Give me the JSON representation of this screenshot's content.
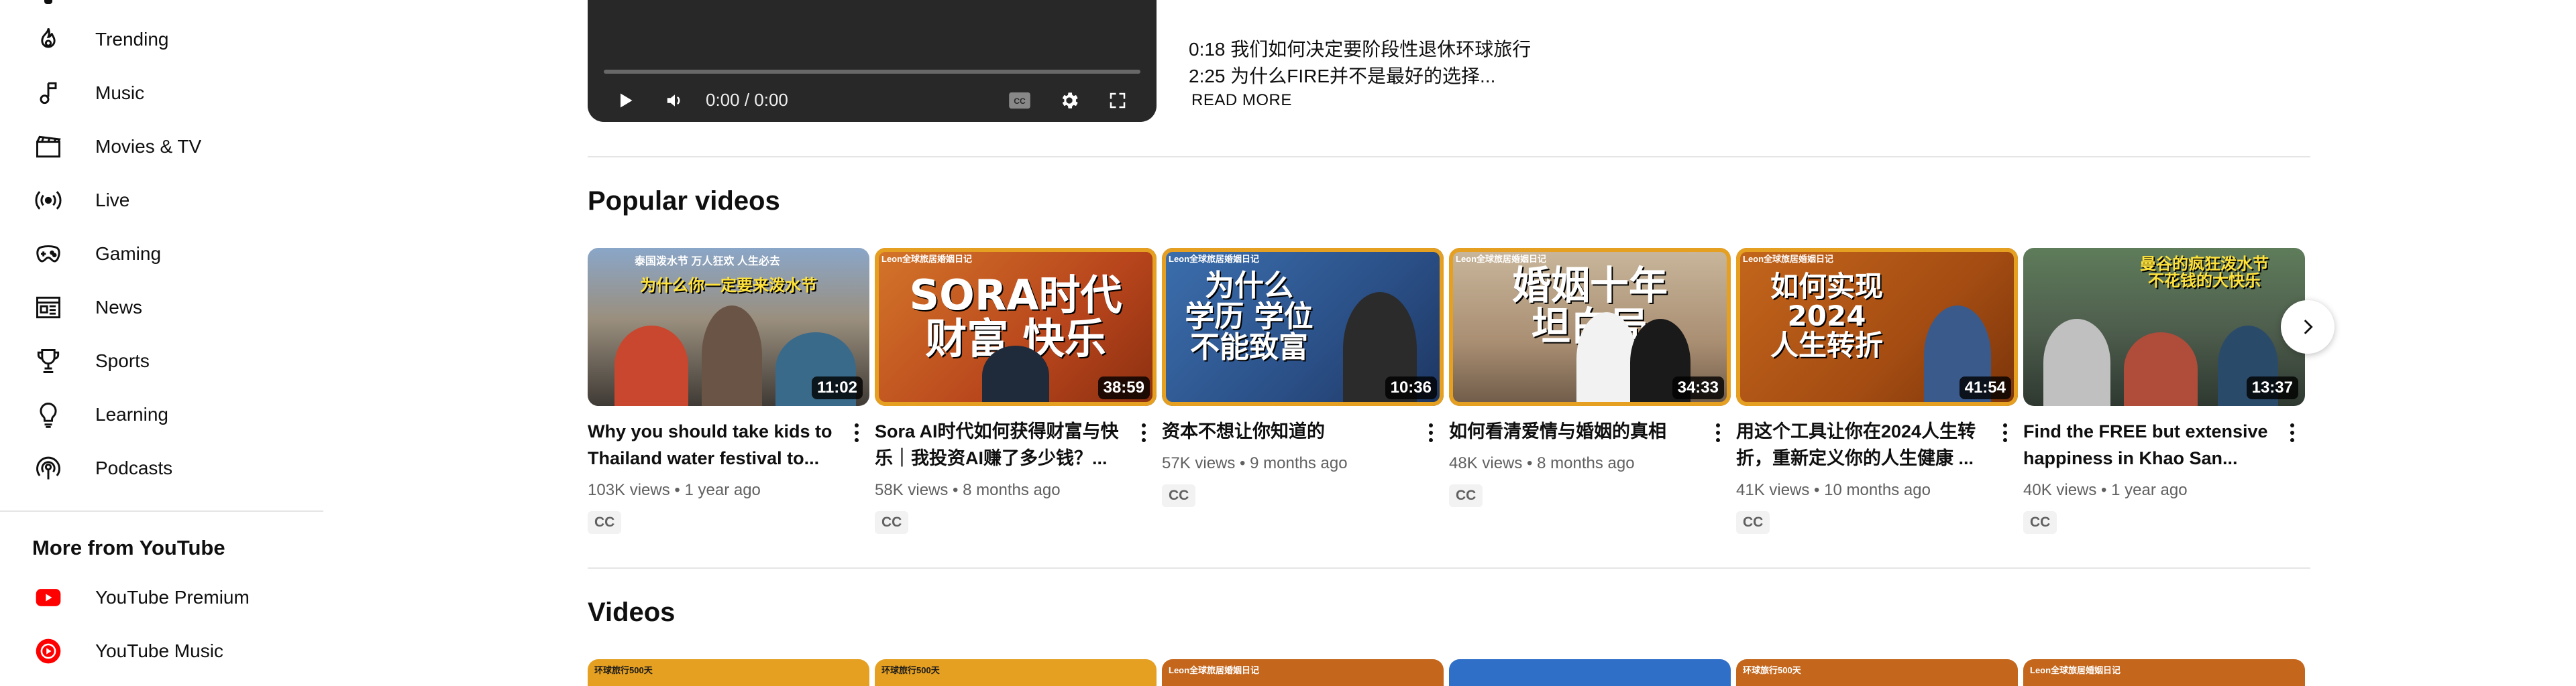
{
  "sidebar": {
    "items": [
      {
        "label": "Trending",
        "icon": "trending-icon"
      },
      {
        "label": "Music",
        "icon": "music-icon"
      },
      {
        "label": "Movies & TV",
        "icon": "movies-icon"
      },
      {
        "label": "Live",
        "icon": "live-icon"
      },
      {
        "label": "Gaming",
        "icon": "gaming-icon"
      },
      {
        "label": "News",
        "icon": "news-icon"
      },
      {
        "label": "Sports",
        "icon": "sports-icon"
      },
      {
        "label": "Learning",
        "icon": "learning-icon"
      },
      {
        "label": "Podcasts",
        "icon": "podcasts-icon"
      }
    ],
    "more_heading": "More from YouTube",
    "more_items": [
      {
        "label": "YouTube Premium",
        "icon": "youtube-premium-icon"
      },
      {
        "label": "YouTube Music",
        "icon": "youtube-music-icon"
      }
    ],
    "brand_red": "#ff0000"
  },
  "player": {
    "time": "0:00 / 0:00",
    "progress": 0
  },
  "description": {
    "lines": [
      "0:18 我们如何决定要阶段性退休环球旅行",
      "2:25 为什么FIRE并不是最好的选择..."
    ],
    "read_more": "READ MORE"
  },
  "popular": {
    "title": "Popular videos",
    "videos": [
      {
        "title": "Why you should take kids to Thailand water festival to...",
        "views": "103K views",
        "age": "1 year ago",
        "duration": "11:02",
        "badge": "CC",
        "thumb_tag": "泰国泼水节 万人狂欢 人生必去",
        "thumb_text": "为什么你一定要来泼水节"
      },
      {
        "title": "Sora AI时代如何获得财富与快乐｜我投资AI赚了多少钱？...",
        "views": "58K views",
        "age": "8 months ago",
        "duration": "38:59",
        "badge": "CC",
        "thumb_tag": "Leon全球旅居婚姻日记",
        "thumb_text": "SORA时代\n财富 快乐"
      },
      {
        "title": "资本不想让你知道的",
        "views": "57K views",
        "age": "9 months ago",
        "duration": "10:36",
        "badge": "CC",
        "thumb_tag": "Leon全球旅居婚姻日记",
        "thumb_text": "为什么\n学历 学位\n不能致富"
      },
      {
        "title": "如何看清爱情与婚姻的真相",
        "views": "48K views",
        "age": "8 months ago",
        "duration": "34:33",
        "badge": "CC",
        "thumb_tag": "Leon全球旅居婚姻日记",
        "thumb_text": "婚姻十年\n坦白局"
      },
      {
        "title": "用这个工具让你在2024人生转折，重新定义你的人生健康 ...",
        "views": "41K views",
        "age": "10 months ago",
        "duration": "41:54",
        "badge": "CC",
        "thumb_tag": "Leon全球旅居婚姻日记",
        "thumb_text": "如何实现\n2024\n人生转折"
      },
      {
        "title": "Find the FREE but extensive happiness in Khao San...",
        "views": "40K views",
        "age": "1 year ago",
        "duration": "13:37",
        "badge": "CC",
        "thumb_tag": "",
        "thumb_text": "曼谷的疯狂泼水节\n不花钱的大快乐"
      }
    ]
  },
  "videos_section": {
    "title": "Videos",
    "thumb_tags": [
      "环球旅行500天",
      "环球旅行500天",
      "Leon全球旅居婚姻日记",
      "",
      "环球旅行500天",
      "Leon全球旅居婚姻日记"
    ]
  },
  "colors": {
    "accent_orange": "#e5a021",
    "text_primary": "#0f0f0f",
    "text_secondary": "#606060"
  }
}
